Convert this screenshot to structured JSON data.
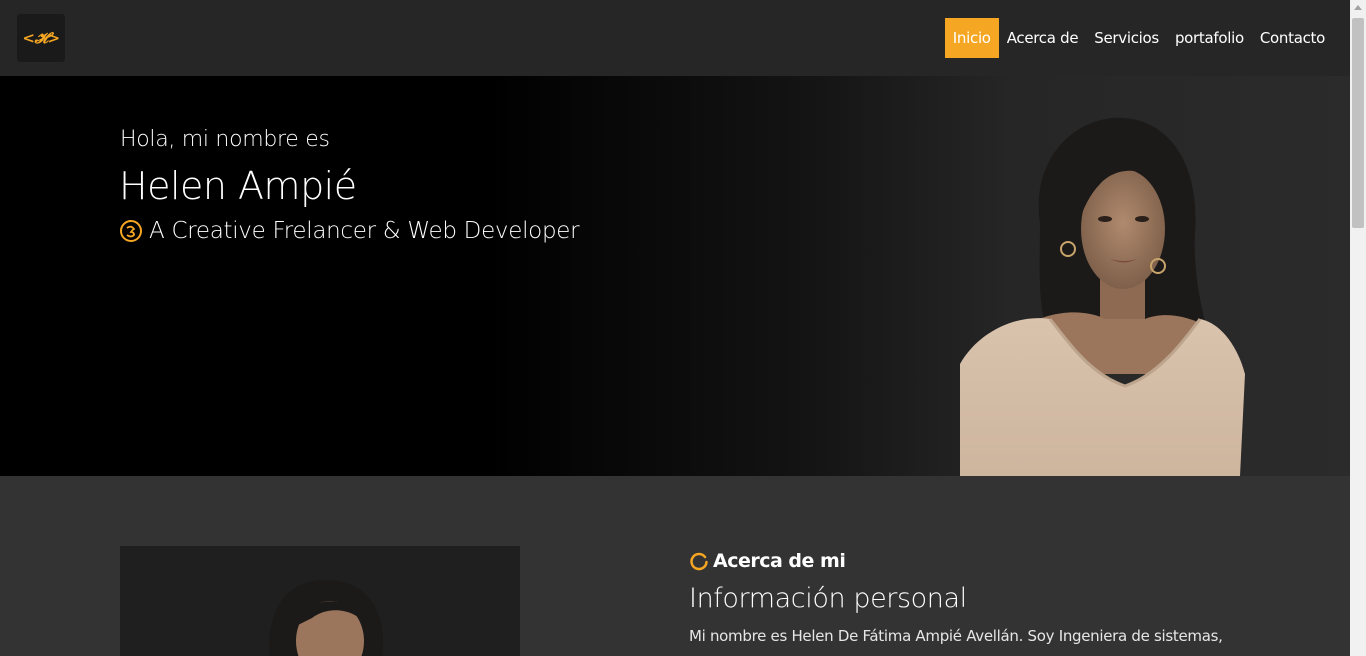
{
  "brand": {
    "logo_text": "<𝓗>"
  },
  "nav": {
    "items": [
      {
        "label": "Inicio",
        "active": true
      },
      {
        "label": "Acerca de",
        "active": false
      },
      {
        "label": "Servicios",
        "active": false
      },
      {
        "label": "portafolio",
        "active": false
      },
      {
        "label": "Contacto",
        "active": false
      }
    ]
  },
  "hero": {
    "greeting": "Hola, mi nombre es",
    "name": "Helen Ampié",
    "tagline": "A Creative Frelancer & Web Developer"
  },
  "about": {
    "label": "Acerca de mi",
    "title": "Información personal",
    "text": "Mi nombre es Helen De Fátima Ampié Avellán. Soy Ingeniera de sistemas,"
  },
  "colors": {
    "accent": "#f5a623",
    "navbar": "#262626",
    "page": "#333333"
  }
}
